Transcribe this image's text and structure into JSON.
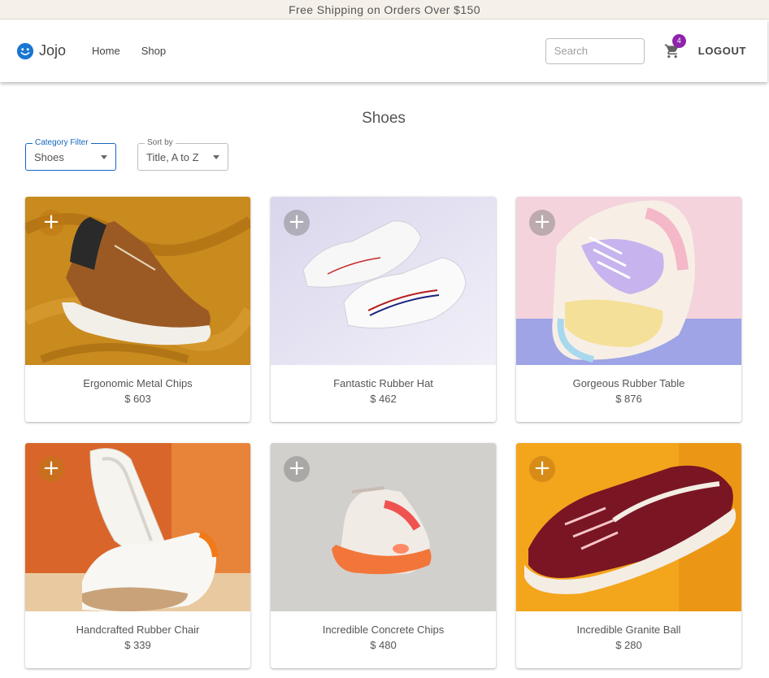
{
  "banner": {
    "text": "Free Shipping on Orders Over $150"
  },
  "header": {
    "brand": "Jojo",
    "nav": [
      "Home",
      "Shop"
    ],
    "search_placeholder": "Search",
    "cart_count": "4",
    "logout_label": "LOGOUT"
  },
  "page": {
    "title": "Shoes"
  },
  "filters": {
    "category": {
      "label": "Category Filter",
      "value": "Shoes"
    },
    "sort": {
      "label": "Sort by",
      "value": "Title, A to Z"
    }
  },
  "products": [
    {
      "name": "Ergonomic Metal Chips",
      "price": "$ 603"
    },
    {
      "name": "Fantastic Rubber Hat",
      "price": "$ 462"
    },
    {
      "name": "Gorgeous Rubber Table",
      "price": "$ 876"
    },
    {
      "name": "Handcrafted Rubber Chair",
      "price": "$ 339"
    },
    {
      "name": "Incredible Concrete Chips",
      "price": "$ 480"
    },
    {
      "name": "Incredible Granite Ball",
      "price": "$ 280"
    }
  ],
  "colors": {
    "accent": "#1565c0",
    "badge": "#8e24aa",
    "banner_bg": "#f5f1ea"
  }
}
